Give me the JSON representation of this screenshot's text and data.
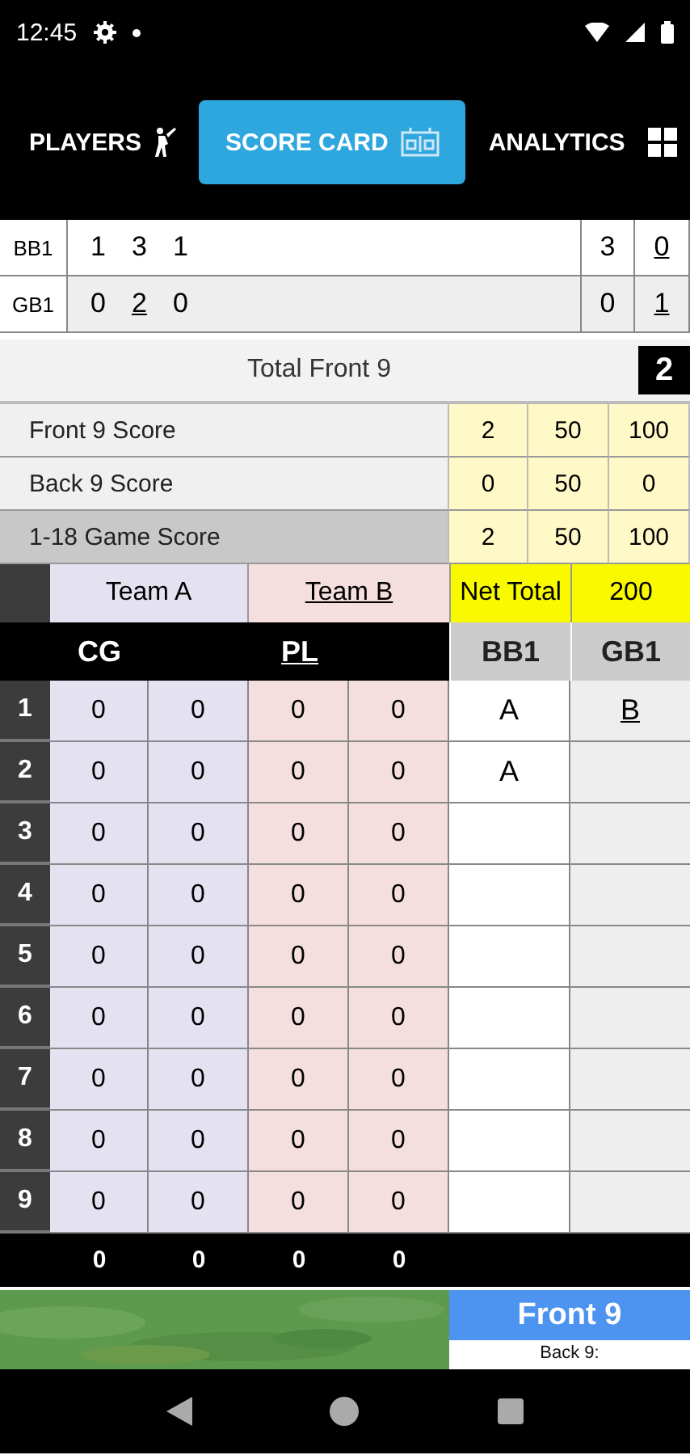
{
  "status_bar": {
    "time": "12:45"
  },
  "tabs": [
    {
      "label": "PLAYERS",
      "selected": false
    },
    {
      "label": "SCORE CARD",
      "selected": true
    },
    {
      "label": "ANALYTICS",
      "selected": false
    }
  ],
  "score_rows": [
    {
      "player": "BB1",
      "strokes": [
        {
          "value": "1",
          "underlined": false
        },
        {
          "value": "3",
          "underlined": false
        },
        {
          "value": "1",
          "underlined": false
        }
      ],
      "total": "3",
      "points": {
        "value": "0",
        "underlined": true
      },
      "shaded": false
    },
    {
      "player": "GB1",
      "strokes": [
        {
          "value": "0",
          "underlined": false
        },
        {
          "value": "2",
          "underlined": true
        },
        {
          "value": "0",
          "underlined": false
        }
      ],
      "total": "0",
      "points": {
        "value": "1",
        "underlined": true
      },
      "shaded": true
    }
  ],
  "total_front_9": {
    "label": "Total Front 9",
    "value": "2"
  },
  "summary_rows": [
    {
      "label": "Front 9 Score",
      "values": [
        "2",
        "50",
        "100"
      ],
      "highlighted": false
    },
    {
      "label": "Back 9 Score",
      "values": [
        "0",
        "50",
        "0"
      ],
      "highlighted": false
    },
    {
      "label": "1-18 Game Score",
      "values": [
        "2",
        "50",
        "100"
      ],
      "highlighted": true
    }
  ],
  "teams": [
    {
      "name": "Team A",
      "underlined": false
    },
    {
      "name": "Team B",
      "underlined": true
    }
  ],
  "net_total": {
    "label": "Net Total",
    "value": "200"
  },
  "columns": [
    {
      "label": "CG",
      "underlined": false
    },
    {
      "label": "PL",
      "underlined": true
    },
    {
      "label": "BB1",
      "underlined": false
    },
    {
      "label": "GB1",
      "underlined": false
    }
  ],
  "holes": [
    {
      "number": "1",
      "team_a": [
        "0",
        "0"
      ],
      "team_b": [
        "0",
        "0"
      ],
      "bb1": {
        "value": "A",
        "underlined": false
      },
      "gb1": {
        "value": "B",
        "underlined": true
      }
    },
    {
      "number": "2",
      "team_a": [
        "0",
        "0"
      ],
      "team_b": [
        "0",
        "0"
      ],
      "bb1": {
        "value": "A",
        "underlined": false
      }
    },
    {
      "number": "3",
      "team_a": [
        "0",
        "0"
      ],
      "team_b": [
        "0",
        "0"
      ]
    },
    {
      "number": "4",
      "team_a": [
        "0",
        "0"
      ],
      "team_b": [
        "0",
        "0"
      ]
    },
    {
      "number": "5",
      "team_a": [
        "0",
        "0"
      ],
      "team_b": [
        "0",
        "0"
      ]
    },
    {
      "number": "6",
      "team_a": [
        "0",
        "0"
      ],
      "team_b": [
        "0",
        "0"
      ]
    },
    {
      "number": "7",
      "team_a": [
        "0",
        "0"
      ],
      "team_b": [
        "0",
        "0"
      ]
    },
    {
      "number": "8",
      "team_a": [
        "0",
        "0"
      ],
      "team_b": [
        "0",
        "0"
      ]
    },
    {
      "number": "9",
      "team_a": [
        "0",
        "0"
      ],
      "team_b": [
        "0",
        "0"
      ]
    }
  ],
  "totals": [
    "0",
    "0",
    "0",
    "0"
  ],
  "nine_buttons": [
    {
      "label": "Front 9",
      "selected": true
    },
    {
      "label": "Back 9:",
      "selected": false
    }
  ]
}
